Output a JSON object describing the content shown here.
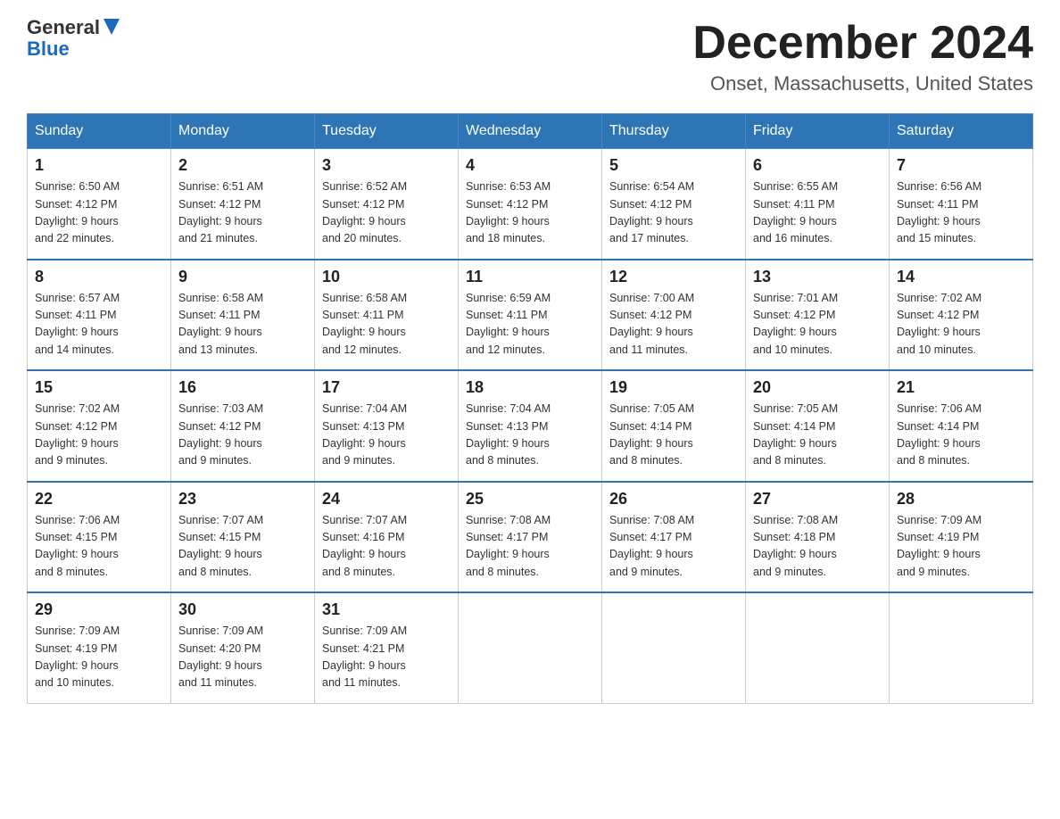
{
  "header": {
    "logo_general": "General",
    "logo_blue": "Blue",
    "month_title": "December 2024",
    "location": "Onset, Massachusetts, United States"
  },
  "weekdays": [
    "Sunday",
    "Monday",
    "Tuesday",
    "Wednesday",
    "Thursday",
    "Friday",
    "Saturday"
  ],
  "weeks": [
    [
      {
        "day": "1",
        "sunrise": "6:50 AM",
        "sunset": "4:12 PM",
        "daylight": "9 hours and 22 minutes."
      },
      {
        "day": "2",
        "sunrise": "6:51 AM",
        "sunset": "4:12 PM",
        "daylight": "9 hours and 21 minutes."
      },
      {
        "day": "3",
        "sunrise": "6:52 AM",
        "sunset": "4:12 PM",
        "daylight": "9 hours and 20 minutes."
      },
      {
        "day": "4",
        "sunrise": "6:53 AM",
        "sunset": "4:12 PM",
        "daylight": "9 hours and 18 minutes."
      },
      {
        "day": "5",
        "sunrise": "6:54 AM",
        "sunset": "4:12 PM",
        "daylight": "9 hours and 17 minutes."
      },
      {
        "day": "6",
        "sunrise": "6:55 AM",
        "sunset": "4:11 PM",
        "daylight": "9 hours and 16 minutes."
      },
      {
        "day": "7",
        "sunrise": "6:56 AM",
        "sunset": "4:11 PM",
        "daylight": "9 hours and 15 minutes."
      }
    ],
    [
      {
        "day": "8",
        "sunrise": "6:57 AM",
        "sunset": "4:11 PM",
        "daylight": "9 hours and 14 minutes."
      },
      {
        "day": "9",
        "sunrise": "6:58 AM",
        "sunset": "4:11 PM",
        "daylight": "9 hours and 13 minutes."
      },
      {
        "day": "10",
        "sunrise": "6:58 AM",
        "sunset": "4:11 PM",
        "daylight": "9 hours and 12 minutes."
      },
      {
        "day": "11",
        "sunrise": "6:59 AM",
        "sunset": "4:11 PM",
        "daylight": "9 hours and 12 minutes."
      },
      {
        "day": "12",
        "sunrise": "7:00 AM",
        "sunset": "4:12 PM",
        "daylight": "9 hours and 11 minutes."
      },
      {
        "day": "13",
        "sunrise": "7:01 AM",
        "sunset": "4:12 PM",
        "daylight": "9 hours and 10 minutes."
      },
      {
        "day": "14",
        "sunrise": "7:02 AM",
        "sunset": "4:12 PM",
        "daylight": "9 hours and 10 minutes."
      }
    ],
    [
      {
        "day": "15",
        "sunrise": "7:02 AM",
        "sunset": "4:12 PM",
        "daylight": "9 hours and 9 minutes."
      },
      {
        "day": "16",
        "sunrise": "7:03 AM",
        "sunset": "4:12 PM",
        "daylight": "9 hours and 9 minutes."
      },
      {
        "day": "17",
        "sunrise": "7:04 AM",
        "sunset": "4:13 PM",
        "daylight": "9 hours and 9 minutes."
      },
      {
        "day": "18",
        "sunrise": "7:04 AM",
        "sunset": "4:13 PM",
        "daylight": "9 hours and 8 minutes."
      },
      {
        "day": "19",
        "sunrise": "7:05 AM",
        "sunset": "4:14 PM",
        "daylight": "9 hours and 8 minutes."
      },
      {
        "day": "20",
        "sunrise": "7:05 AM",
        "sunset": "4:14 PM",
        "daylight": "9 hours and 8 minutes."
      },
      {
        "day": "21",
        "sunrise": "7:06 AM",
        "sunset": "4:14 PM",
        "daylight": "9 hours and 8 minutes."
      }
    ],
    [
      {
        "day": "22",
        "sunrise": "7:06 AM",
        "sunset": "4:15 PM",
        "daylight": "9 hours and 8 minutes."
      },
      {
        "day": "23",
        "sunrise": "7:07 AM",
        "sunset": "4:15 PM",
        "daylight": "9 hours and 8 minutes."
      },
      {
        "day": "24",
        "sunrise": "7:07 AM",
        "sunset": "4:16 PM",
        "daylight": "9 hours and 8 minutes."
      },
      {
        "day": "25",
        "sunrise": "7:08 AM",
        "sunset": "4:17 PM",
        "daylight": "9 hours and 8 minutes."
      },
      {
        "day": "26",
        "sunrise": "7:08 AM",
        "sunset": "4:17 PM",
        "daylight": "9 hours and 9 minutes."
      },
      {
        "day": "27",
        "sunrise": "7:08 AM",
        "sunset": "4:18 PM",
        "daylight": "9 hours and 9 minutes."
      },
      {
        "day": "28",
        "sunrise": "7:09 AM",
        "sunset": "4:19 PM",
        "daylight": "9 hours and 9 minutes."
      }
    ],
    [
      {
        "day": "29",
        "sunrise": "7:09 AM",
        "sunset": "4:19 PM",
        "daylight": "9 hours and 10 minutes."
      },
      {
        "day": "30",
        "sunrise": "7:09 AM",
        "sunset": "4:20 PM",
        "daylight": "9 hours and 11 minutes."
      },
      {
        "day": "31",
        "sunrise": "7:09 AM",
        "sunset": "4:21 PM",
        "daylight": "9 hours and 11 minutes."
      },
      null,
      null,
      null,
      null
    ]
  ]
}
